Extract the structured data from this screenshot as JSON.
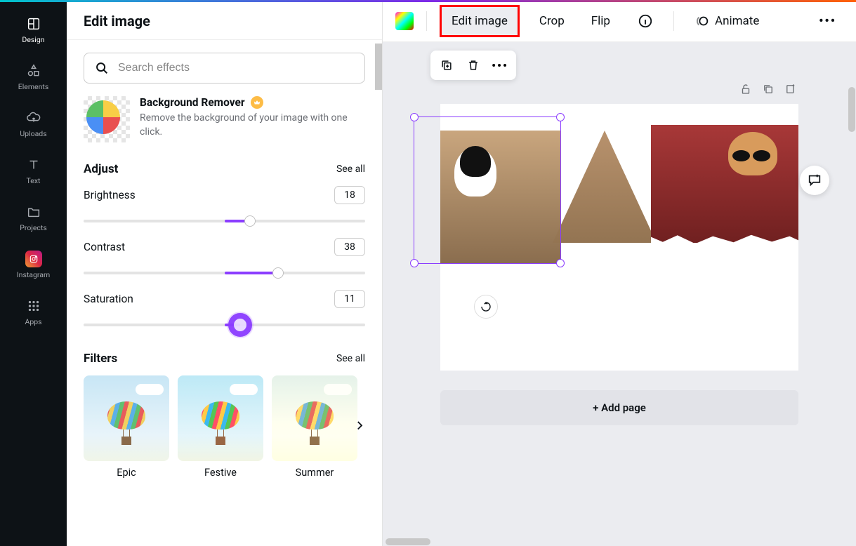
{
  "sidebar": {
    "items": [
      {
        "label": "Design"
      },
      {
        "label": "Elements"
      },
      {
        "label": "Uploads"
      },
      {
        "label": "Text"
      },
      {
        "label": "Projects"
      },
      {
        "label": "Instagram"
      },
      {
        "label": "Apps"
      }
    ]
  },
  "panel": {
    "title": "Edit image",
    "search_placeholder": "Search effects",
    "bg_remover": {
      "title": "Background Remover",
      "desc": "Remove the background of your image with one click."
    },
    "adjust": {
      "title": "Adjust",
      "see_all": "See all",
      "brightness": {
        "label": "Brightness",
        "value": "18",
        "pct": 59
      },
      "contrast": {
        "label": "Contrast",
        "value": "38",
        "pct": 69
      },
      "saturation": {
        "label": "Saturation",
        "value": "11",
        "pct": 55.5
      }
    },
    "filters": {
      "title": "Filters",
      "see_all": "See all",
      "items": [
        {
          "name": "Epic"
        },
        {
          "name": "Festive"
        },
        {
          "name": "Summer"
        }
      ]
    }
  },
  "toolbar": {
    "edit_image": "Edit image",
    "crop": "Crop",
    "flip": "Flip",
    "animate": "Animate"
  },
  "canvas": {
    "add_page": "+ Add page"
  }
}
